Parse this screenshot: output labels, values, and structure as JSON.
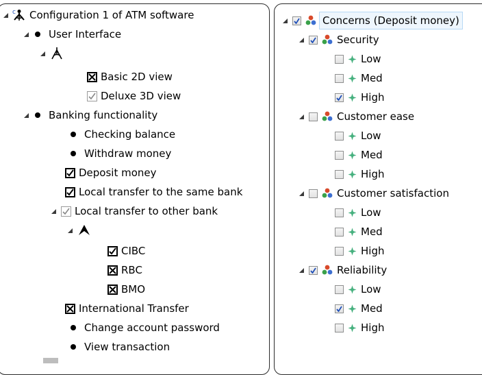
{
  "feature_tree": {
    "root": {
      "label": "Configuration 1 of ATM software",
      "badge": "c"
    },
    "user_interface": "User Interface",
    "basic_2d_view": "Basic 2D view",
    "deluxe_3d_view": "Deluxe 3D view",
    "banking_functionality": "Banking functionality",
    "checking_balance": "Checking balance",
    "withdraw_money": "Withdraw money",
    "deposit_money": "Deposit money",
    "local_transfer_same_bank": "Local transfer to the same bank",
    "local_transfer_other_bank": "Local transfer to other bank",
    "cibc": "CIBC",
    "rbc": "RBC",
    "bmo": "BMO",
    "international_transfer": "International Transfer",
    "change_account_password": "Change account password",
    "view_transaction": "View transaction"
  },
  "concern_tree": {
    "root": {
      "label": "Concerns (Deposit money)",
      "checked": true
    },
    "concerns": [
      {
        "label": "Security",
        "checked": true,
        "levels": [
          {
            "label": "Low",
            "checked": false
          },
          {
            "label": "Med",
            "checked": false
          },
          {
            "label": "High",
            "checked": true
          }
        ]
      },
      {
        "label": "Customer ease",
        "checked": false,
        "levels": [
          {
            "label": "Low",
            "checked": false
          },
          {
            "label": "Med",
            "checked": false
          },
          {
            "label": "High",
            "checked": false
          }
        ]
      },
      {
        "label": "Customer satisfaction",
        "checked": false,
        "levels": [
          {
            "label": "Low",
            "checked": false
          },
          {
            "label": "Med",
            "checked": false
          },
          {
            "label": "High",
            "checked": false
          }
        ]
      },
      {
        "label": "Reliability",
        "checked": true,
        "levels": [
          {
            "label": "Low",
            "checked": false
          },
          {
            "label": "Med",
            "checked": true
          },
          {
            "label": "High",
            "checked": false
          }
        ]
      }
    ]
  },
  "colors": {
    "concern_icon_red": "#d84a2b",
    "concern_icon_green": "#3aa14a",
    "concern_icon_blue": "#3d6fd1",
    "level_icon": "#46b07e",
    "check_blue": "#1f4fb8"
  }
}
